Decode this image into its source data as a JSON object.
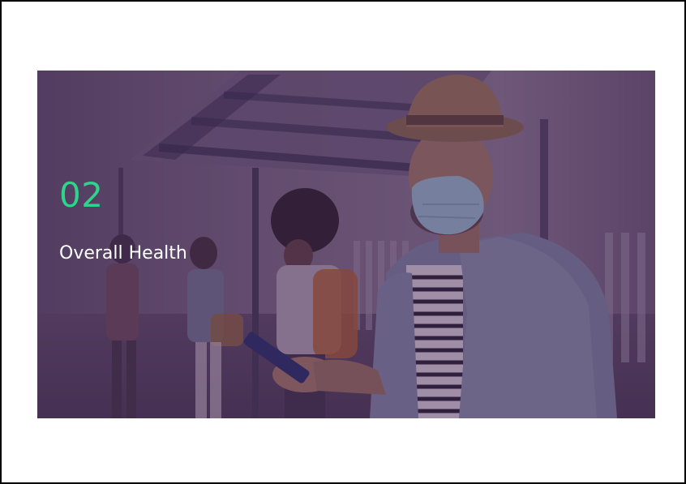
{
  "slide": {
    "number": "02",
    "title": "Overall Health",
    "number_color": "#2fd48b",
    "title_color": "#ffffff",
    "overlay_color": "#46285580"
  },
  "photo": {
    "icon": "photo-illustration"
  }
}
